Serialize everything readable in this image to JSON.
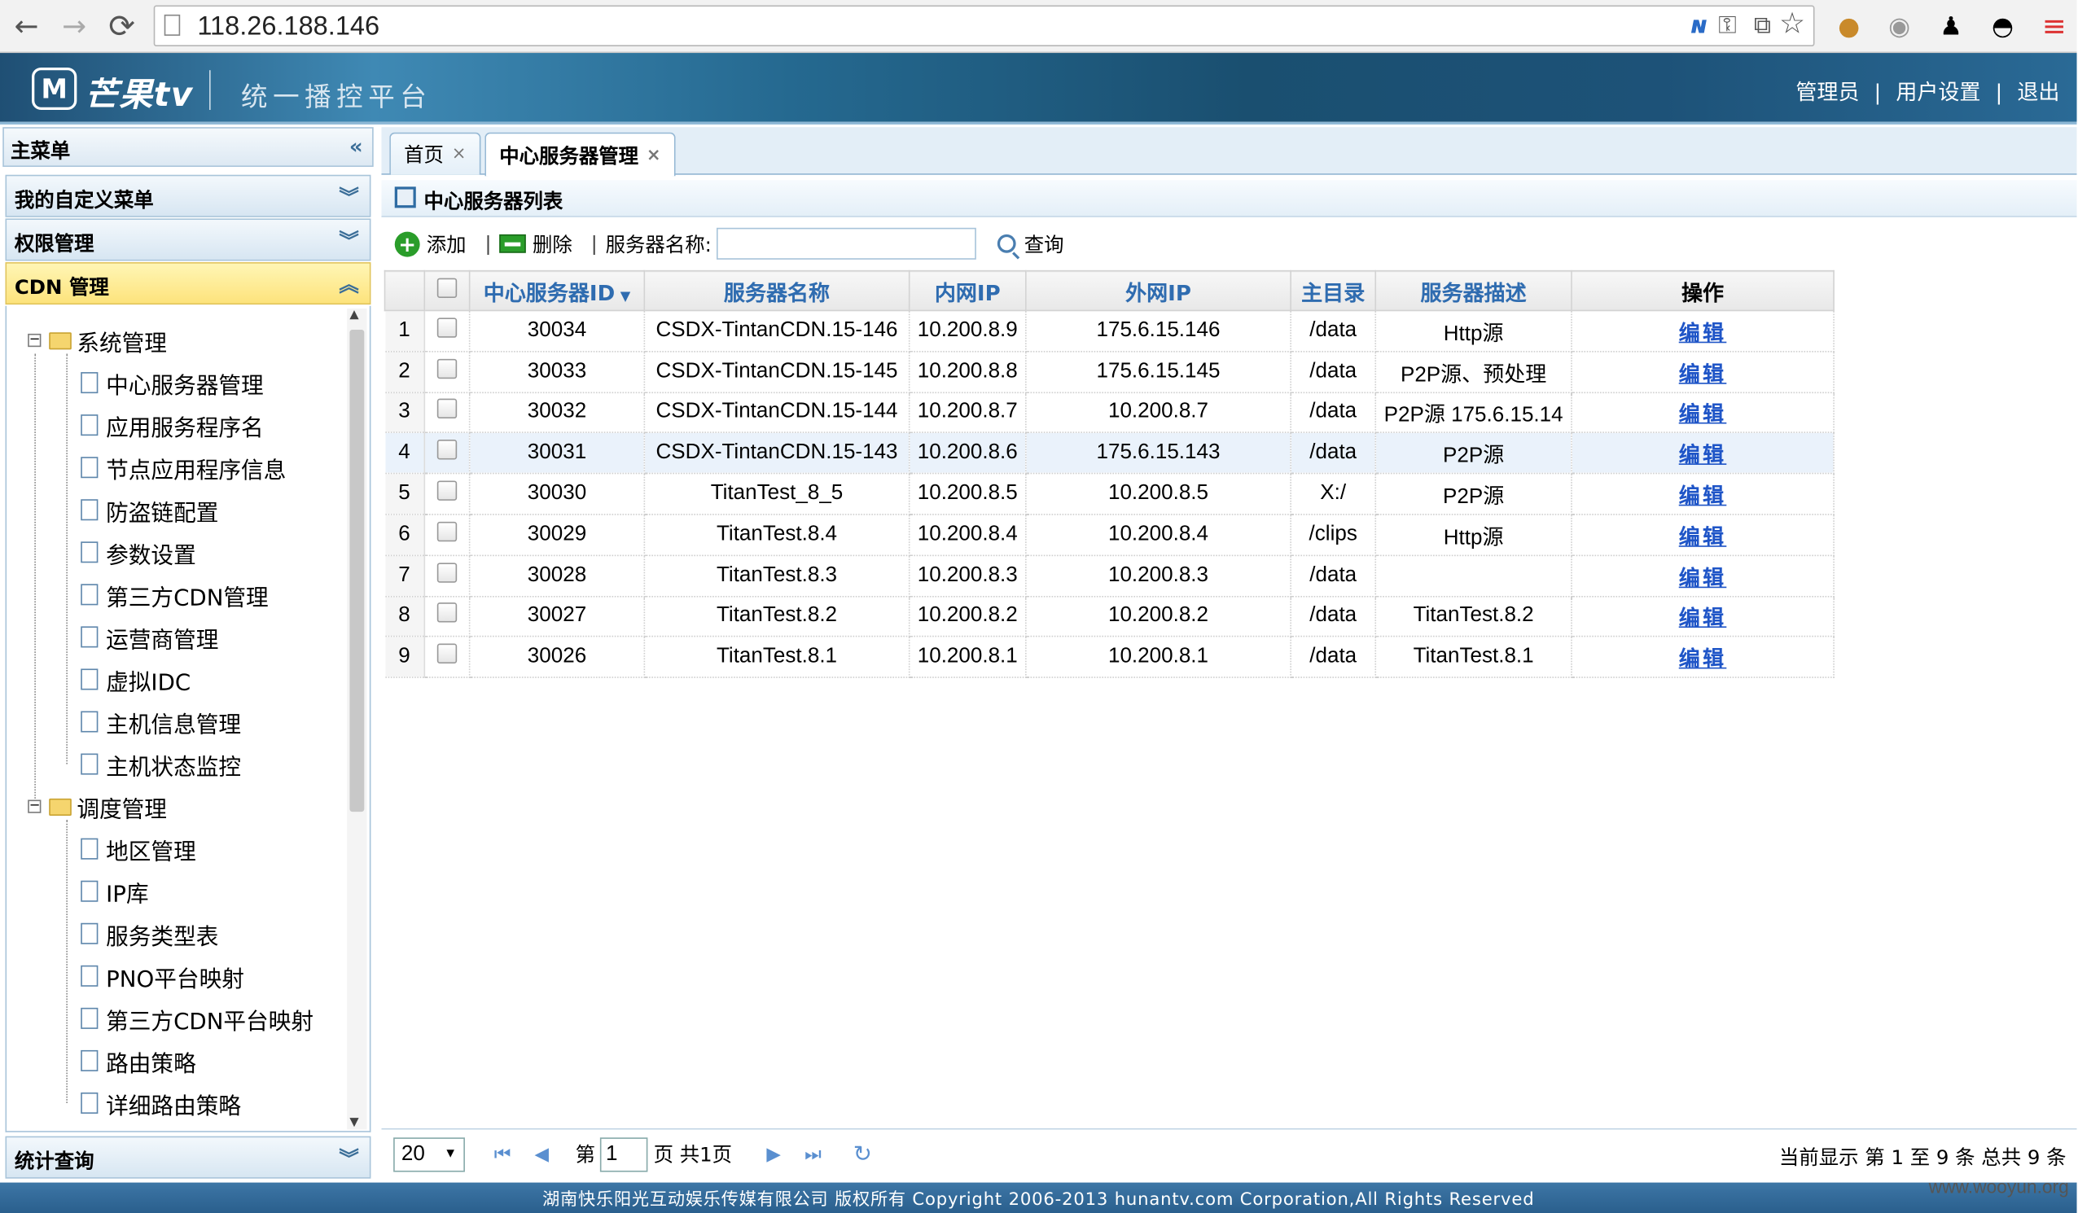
{
  "browser": {
    "url": "118.26.188.146",
    "nav": {
      "back": "←",
      "forward": "→",
      "reload": "⟳"
    }
  },
  "header": {
    "logo_mark": "M",
    "logo_text": "芒果tv",
    "platform": "统一播控平台",
    "links": [
      "管理员",
      "用户设置",
      "退出"
    ],
    "link_sep": "|"
  },
  "sidebar": {
    "title": "主菜单",
    "collapse": "«",
    "groups": [
      {
        "label": "我的自定义菜单",
        "chev": "︾"
      },
      {
        "label": "权限管理",
        "chev": "︾"
      },
      {
        "label": "CDN 管理",
        "chev": "︽"
      },
      {
        "label": "统计查询",
        "chev": "︾"
      }
    ],
    "tree": {
      "folder1": "系统管理",
      "items1": [
        "中心服务器管理",
        "应用服务程序名",
        "节点应用程序信息",
        "防盗链配置",
        "参数设置",
        "第三方CDN管理",
        "运营商管理",
        "虚拟IDC",
        "主机信息管理",
        "主机状态监控"
      ],
      "folder2": "调度管理",
      "items2": [
        "地区管理",
        "IP库",
        "服务类型表",
        "PNO平台映射",
        "第三方CDN平台映射",
        "路由策略",
        "详细路由策略"
      ]
    }
  },
  "tabs": [
    {
      "label": "首页",
      "close": "×"
    },
    {
      "label": "中心服务器管理",
      "close": "×"
    }
  ],
  "panel": {
    "title": "中心服务器列表"
  },
  "toolbar": {
    "add": "添加",
    "delete": "删除",
    "sep": "|",
    "name_label": "服务器名称:",
    "name_value": "",
    "search": "查询"
  },
  "grid": {
    "columns": [
      "中心服务器ID",
      "服务器名称",
      "内网IP",
      "外网IP",
      "主目录",
      "服务器描述",
      "操作"
    ],
    "sort_indicator": "▼",
    "action_label": "编辑",
    "rows": [
      {
        "n": "1",
        "id": "30034",
        "name": "CSDX-TintanCDN.15-146",
        "ip_in": "10.200.8.9",
        "ip_out": "175.6.15.146",
        "dir": "/data",
        "desc": "Http源"
      },
      {
        "n": "2",
        "id": "30033",
        "name": "CSDX-TintanCDN.15-145",
        "ip_in": "10.200.8.8",
        "ip_out": "175.6.15.145",
        "dir": "/data",
        "desc": "P2P源、预处理"
      },
      {
        "n": "3",
        "id": "30032",
        "name": "CSDX-TintanCDN.15-144",
        "ip_in": "10.200.8.7",
        "ip_out": "10.200.8.7",
        "dir": "/data",
        "desc": "P2P源 175.6.15.14"
      },
      {
        "n": "4",
        "id": "30031",
        "name": "CSDX-TintanCDN.15-143",
        "ip_in": "10.200.8.6",
        "ip_out": "175.6.15.143",
        "dir": "/data",
        "desc": "P2P源"
      },
      {
        "n": "5",
        "id": "30030",
        "name": "TitanTest_8_5",
        "ip_in": "10.200.8.5",
        "ip_out": "10.200.8.5",
        "dir": "X:/",
        "desc": "P2P源"
      },
      {
        "n": "6",
        "id": "30029",
        "name": "TitanTest.8.4",
        "ip_in": "10.200.8.4",
        "ip_out": "10.200.8.4",
        "dir": "/clips",
        "desc": "Http源"
      },
      {
        "n": "7",
        "id": "30028",
        "name": "TitanTest.8.3",
        "ip_in": "10.200.8.3",
        "ip_out": "10.200.8.3",
        "dir": "/data",
        "desc": ""
      },
      {
        "n": "8",
        "id": "30027",
        "name": "TitanTest.8.2",
        "ip_in": "10.200.8.2",
        "ip_out": "10.200.8.2",
        "dir": "/data",
        "desc": "TitanTest.8.2"
      },
      {
        "n": "9",
        "id": "30026",
        "name": "TitanTest.8.1",
        "ip_in": "10.200.8.1",
        "ip_out": "10.200.8.1",
        "dir": "/data",
        "desc": "TitanTest.8.1"
      }
    ]
  },
  "pager": {
    "page_size": "20",
    "page_prefix": "第",
    "page_value": "1",
    "page_suffix": "页 共1页",
    "info": "当前显示 第 1 至 9 条 总共 9 条"
  },
  "footer": {
    "text": "湖南快乐阳光互动娱乐传媒有限公司 版权所有 Copyright 2006-2013 hunantv.com Corporation,All Rights Reserved"
  },
  "watermark": "www.wooyun.org"
}
